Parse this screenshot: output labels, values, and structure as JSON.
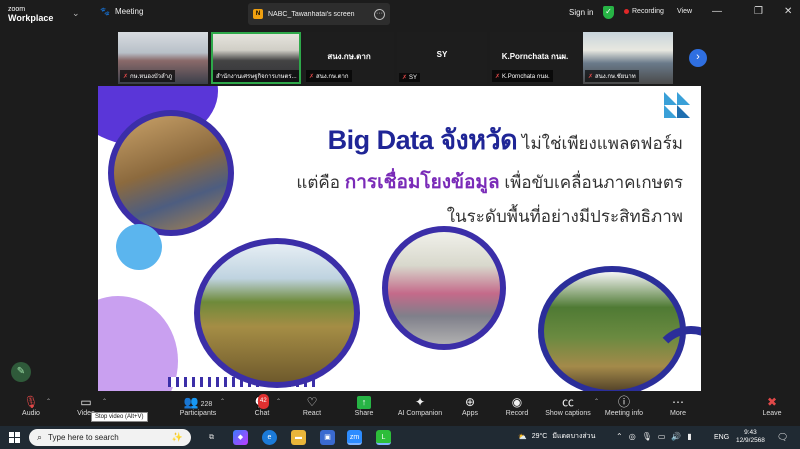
{
  "titlebar": {
    "logo_top": "zoom",
    "logo_bottom": "Workplace",
    "meeting_label": "Meeting",
    "share_tab_badge": "N",
    "share_tab_label": "NABC_Tawanhatai's screen",
    "sign_in": "Sign in",
    "recording": "Recording",
    "view": "View"
  },
  "participants": [
    {
      "name": "กษ.หนองบัวลำภู",
      "muted": true,
      "kind": "video"
    },
    {
      "name": "สำนักงานเศรษฐกิจการเกษตร...",
      "muted": false,
      "kind": "video",
      "active": true
    },
    {
      "big": "สนง.กษ.ตาก",
      "name": "สนง.กษ.ตาก",
      "muted": true,
      "kind": "name"
    },
    {
      "big": "SY",
      "name": "SY",
      "muted": true,
      "kind": "name"
    },
    {
      "big": "K.Pornchata กนผ.",
      "name": "K.Pornchata กนผ.",
      "muted": true,
      "kind": "name"
    },
    {
      "name": "สนง.กษ.ชัยนาท",
      "muted": true,
      "kind": "video"
    }
  ],
  "slide": {
    "title_en": "Big Data ",
    "title_th": "จังหวัด",
    "title_rest": " ไม่ใช่เพียงแพลตฟอร์ม",
    "line2_pre": "แต่คือ ",
    "line2_highlight": "การเชื่อมโยงข้อมูล",
    "line2_post": " เพื่อขับเคลื่อนภาคเกษตร",
    "line3": "ในระดับพื้นที่อย่างมีประสิทธิภาพ"
  },
  "toolbar": {
    "audio": "Audio",
    "video": "Video",
    "participants": "Participants",
    "participants_count": "228",
    "chat": "Chat",
    "chat_badge": "42",
    "react": "React",
    "share": "Share",
    "ai_companion": "AI Companion",
    "apps": "Apps",
    "record": "Record",
    "show_captions": "Show captions",
    "meeting_info": "Meeting info",
    "more": "More",
    "leave": "Leave",
    "tooltip": "Stop video (Alt+V)"
  },
  "taskbar": {
    "search_placeholder": "Type here to search",
    "weather_temp": "29°C",
    "weather_desc": "มีแดดบางส่วน",
    "lang": "ENG",
    "time": "9:43",
    "date": "12/9/2568"
  },
  "colors": {
    "accent_green": "#27b445",
    "record_red": "#e02828",
    "slide_blue": "#1f2596",
    "slide_purple": "#7a2bb8"
  }
}
